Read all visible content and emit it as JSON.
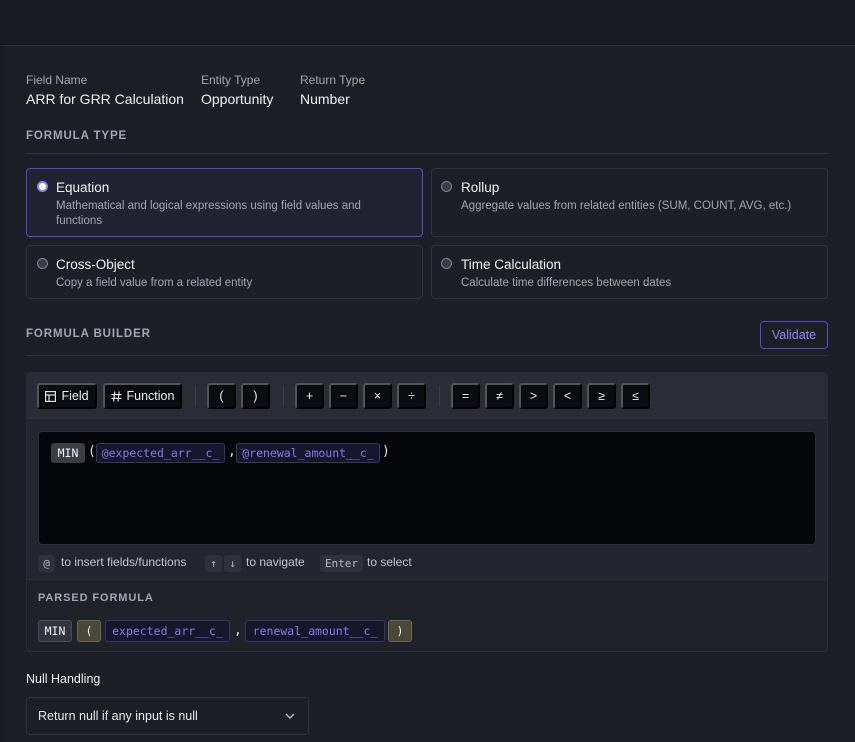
{
  "field_meta": {
    "field_name_label": "Field Name",
    "field_name_value": "ARR for GRR Calculation",
    "entity_type_label": "Entity Type",
    "entity_type_value": "Opportunity",
    "return_type_label": "Return Type",
    "return_type_value": "Number"
  },
  "formula_type": {
    "section_title": "FORMULA TYPE",
    "selected": "equation",
    "options": [
      {
        "title": "Equation",
        "description_line1": "Mathematical and logical expressions using field values and",
        "description_line2": "functions"
      },
      {
        "title": "Rollup",
        "description_line1": "Aggregate values from related entities (SUM, COUNT, AVG, etc.)"
      },
      {
        "title": "Cross-Object",
        "description_line1": "Copy a field value from a related entity"
      },
      {
        "title": "Time Calculation",
        "description_line1": "Calculate time differences between dates"
      }
    ]
  },
  "formula_builder": {
    "section_title": "FORMULA BUILDER",
    "validate_label": "Validate",
    "toolbar": {
      "field_label": "Field",
      "function_label": "Function",
      "paren_open": "(",
      "paren_close": ")",
      "plus": "+",
      "minus": "−",
      "multiply": "×",
      "divide": "÷",
      "equals": "=",
      "not_equals": "≠",
      "greater": ">",
      "less": "<",
      "gte": "≥",
      "lte": "≤"
    },
    "editor": {
      "function_token": "MIN",
      "open": "(",
      "arg1": "@expected_arr__c_",
      "comma": ",",
      "arg2": "@renewal_amount__c_",
      "close": ")"
    },
    "hints": {
      "at_key": "@",
      "at_text": "to insert fields/functions",
      "up_key": "↑",
      "down_key": "↓",
      "nav_text": "to navigate",
      "enter_key": "Enter",
      "enter_text": "to select"
    },
    "parsed": {
      "title": "PARSED FORMULA",
      "fn": "MIN",
      "open": "(",
      "arg1": "expected_arr__c_",
      "comma": ",",
      "arg2": "renewal_amount__c_",
      "close": ")"
    }
  },
  "null_handling": {
    "label": "Null Handling",
    "selected_value": "Return null if any input is null"
  },
  "colors": {
    "accent": "#8f82f5",
    "accent_border": "#574bc8",
    "background": "#1d1f27"
  }
}
